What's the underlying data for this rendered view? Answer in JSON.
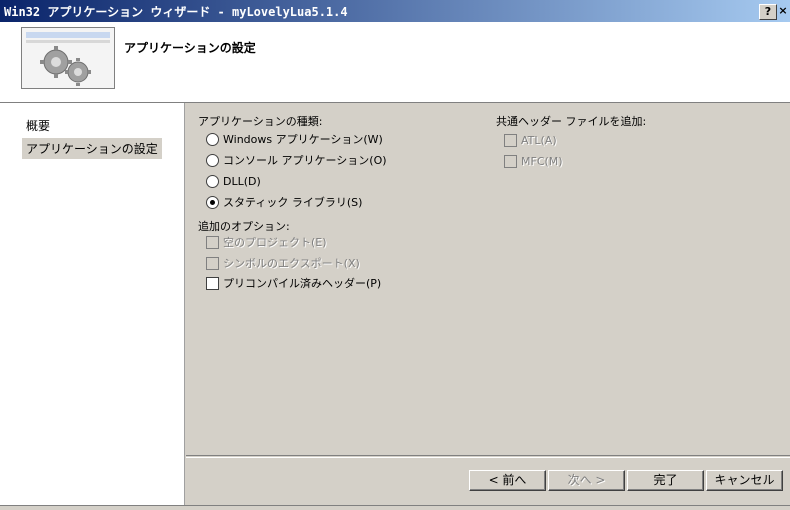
{
  "window": {
    "title": "Win32 アプリケーション ウィザード - myLovelyLua5.1.4",
    "help_button": "?",
    "close_button": "×"
  },
  "header": {
    "title": "アプリケーションの設定"
  },
  "sidebar": {
    "items": [
      {
        "label": "概要",
        "selected": false
      },
      {
        "label": "アプリケーションの設定",
        "selected": true
      }
    ]
  },
  "app_type": {
    "label": "アプリケーションの種類:",
    "options": [
      {
        "label": "Windows アプリケーション(W)",
        "selected": false
      },
      {
        "label": "コンソール アプリケーション(O)",
        "selected": false
      },
      {
        "label": "DLL(D)",
        "selected": false
      },
      {
        "label": "スタティック ライブラリ(S)",
        "selected": true
      }
    ]
  },
  "additional_options": {
    "label": "追加のオプション:",
    "options": [
      {
        "label": "空のプロジェクト(E)",
        "checked": false,
        "enabled": false
      },
      {
        "label": "シンボルのエクスポート(X)",
        "checked": false,
        "enabled": false
      },
      {
        "label": "プリコンパイル済みヘッダー(P)",
        "checked": false,
        "enabled": true
      }
    ]
  },
  "common_headers": {
    "label": "共通ヘッダー ファイルを追加:",
    "options": [
      {
        "label": "ATL(A)",
        "checked": false,
        "enabled": false
      },
      {
        "label": "MFC(M)",
        "checked": false,
        "enabled": false
      }
    ]
  },
  "buttons": {
    "back": "< 前へ",
    "next": "次へ >",
    "finish": "完了",
    "cancel": "キャンセル"
  }
}
